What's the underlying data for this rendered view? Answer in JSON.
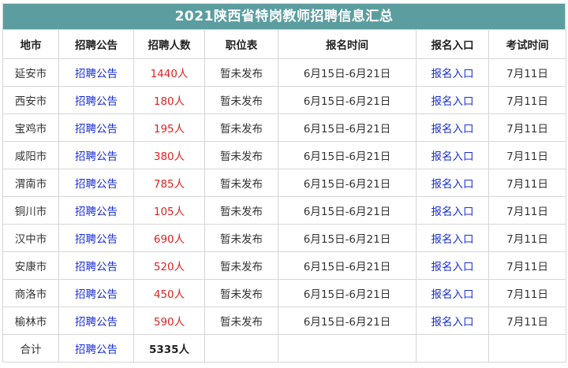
{
  "title": "2021陕西省特岗教师招聘信息汇总",
  "headers": [
    "地市",
    "招聘公告",
    "招聘人数",
    "职位表",
    "报名时间",
    "报名入口",
    "考试时间"
  ],
  "rows": [
    {
      "city": "延安市",
      "notice": "招聘公告",
      "count": "1440人",
      "positions": "暂未发布",
      "reg_time": "6月15日-6月21日",
      "reg_entry": "报名入口",
      "exam_time": "7月11日"
    },
    {
      "city": "西安市",
      "notice": "招聘公告",
      "count": "180人",
      "positions": "暂未发布",
      "reg_time": "6月15日-6月21日",
      "reg_entry": "报名入口",
      "exam_time": "7月11日"
    },
    {
      "city": "宝鸡市",
      "notice": "招聘公告",
      "count": "195人",
      "positions": "暂未发布",
      "reg_time": "6月15日-6月21日",
      "reg_entry": "报名入口",
      "exam_time": "7月11日"
    },
    {
      "city": "咸阳市",
      "notice": "招聘公告",
      "count": "380人",
      "positions": "暂未发布",
      "reg_time": "6月15日-6月21日",
      "reg_entry": "报名入口",
      "exam_time": "7月11日"
    },
    {
      "city": "渭南市",
      "notice": "招聘公告",
      "count": "785人",
      "positions": "暂未发布",
      "reg_time": "6月15日-6月21日",
      "reg_entry": "报名入口",
      "exam_time": "7月11日"
    },
    {
      "city": "铜川市",
      "notice": "招聘公告",
      "count": "105人",
      "positions": "暂未发布",
      "reg_time": "6月15日-6月21日",
      "reg_entry": "报名入口",
      "exam_time": "7月11日"
    },
    {
      "city": "汉中市",
      "notice": "招聘公告",
      "count": "690人",
      "positions": "暂未发布",
      "reg_time": "6月15日-6月21日",
      "reg_entry": "报名入口",
      "exam_time": "7月11日"
    },
    {
      "city": "安康市",
      "notice": "招聘公告",
      "count": "520人",
      "positions": "暂未发布",
      "reg_time": "6月15日-6月21日",
      "reg_entry": "报名入口",
      "exam_time": "7月11日"
    },
    {
      "city": "商洛市",
      "notice": "招聘公告",
      "count": "450人",
      "positions": "暂未发布",
      "reg_time": "6月15日-6月21日",
      "reg_entry": "报名入口",
      "exam_time": "7月11日"
    },
    {
      "city": "榆林市",
      "notice": "招聘公告",
      "count": "590人",
      "positions": "暂未发布",
      "reg_time": "6月15日-6月21日",
      "reg_entry": "报名入口",
      "exam_time": "7月11日"
    }
  ],
  "total": {
    "label": "合计",
    "notice": "招聘公告",
    "count": "5335人"
  },
  "colors": {
    "title_bg": "#5c9ea0",
    "count_red": "#e02222",
    "link_blue": "#1a2fd6",
    "border": "#d6d6d6"
  }
}
